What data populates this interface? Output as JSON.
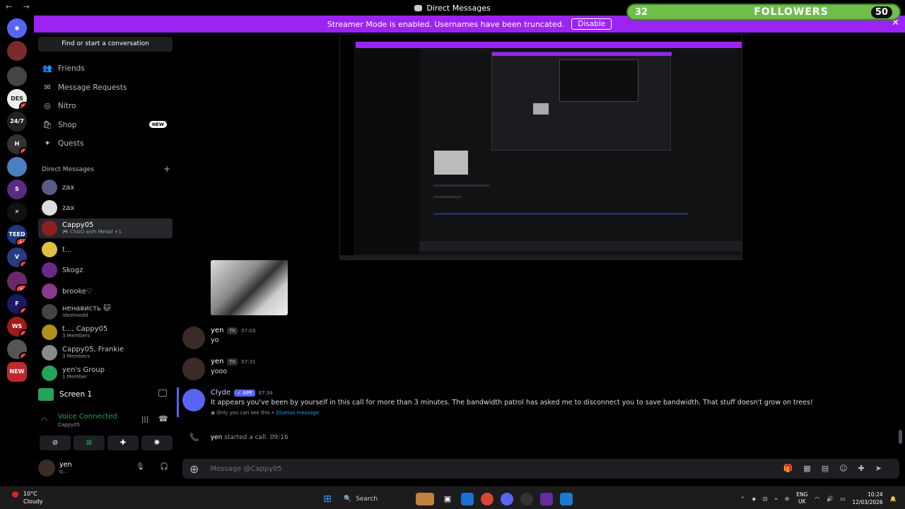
{
  "window": {
    "title": "Direct Messages",
    "nav_arrows": "← →",
    "controls": "— ▢ ✕"
  },
  "banner": {
    "text": "Streamer Mode is enabled. Usernames have been truncated.",
    "button": "Disable",
    "close": "✕"
  },
  "followers": {
    "current": "32",
    "label": "FOLLOWERS",
    "goal": "50"
  },
  "rail": {
    "servers": [
      {
        "icon": "discord-home-icon",
        "glyph": "◉",
        "color": "#5865f2",
        "badge": ""
      },
      {
        "glyph": "",
        "color": "#7a2a2a",
        "badge": ""
      },
      {
        "glyph": "",
        "color": "#444444",
        "badge": ""
      },
      {
        "glyph": "DES",
        "color": "#eeeeee",
        "badge": "1"
      },
      {
        "glyph": "24/7",
        "color": "#222222",
        "badge": ""
      },
      {
        "glyph": "H",
        "color": "#333333",
        "badge": "1"
      },
      {
        "glyph": "",
        "color": "#4a80c0",
        "badge": ""
      },
      {
        "glyph": "S",
        "color": "#5a2a80",
        "badge": ""
      },
      {
        "glyph": "✕",
        "color": "#111111",
        "badge": ""
      },
      {
        "glyph": "TEED",
        "color": "#1a3a80",
        "badge": "12"
      },
      {
        "glyph": "V",
        "color": "#2a3a80",
        "badge": "4"
      },
      {
        "glyph": "",
        "color": "#6a2a6a",
        "badge": "23"
      },
      {
        "glyph": "F",
        "color": "#1a1a60",
        "badge": "1"
      },
      {
        "glyph": "WS",
        "color": "#a01a1a",
        "badge": "1"
      },
      {
        "glyph": "",
        "color": "#555555",
        "badge": "4"
      },
      {
        "glyph": "NEW",
        "color": "#c0282d",
        "badge": ""
      }
    ]
  },
  "sidebar": {
    "find_placeholder": "Find or start a conversation",
    "nav": [
      {
        "label": "Friends",
        "icon": "👥"
      },
      {
        "label": "Message Requests",
        "icon": "✉"
      },
      {
        "label": "Nitro",
        "icon": "◎"
      },
      {
        "label": "Shop",
        "icon": "🛍",
        "tag": "NEW"
      },
      {
        "label": "Quests",
        "icon": "✦"
      }
    ],
    "dm_header": "Direct Messages",
    "dm_add": "+",
    "dms": [
      {
        "name": "zax",
        "sub": "",
        "color": "#5b5b8a"
      },
      {
        "name": "zax",
        "sub": "",
        "color": "#dddddd"
      },
      {
        "name": "Cappy05",
        "sub": "🎮 CSGO with Medal +1",
        "color": "#8a2020",
        "active": true
      },
      {
        "name": "t...",
        "sub": "",
        "color": "#e0c040"
      },
      {
        "name": "Skogz",
        "sub": "",
        "color": "#6a2a8a"
      },
      {
        "name": "brooke♡",
        "sub": "",
        "color": "#8a3a8a"
      },
      {
        "name": "ненависть 🐱",
        "sub": "/deshoodd",
        "color": "#444444"
      },
      {
        "name": "t..., Cappy05",
        "sub": "3 Members",
        "color": "#b09020"
      },
      {
        "name": "Cappy05, Frankie",
        "sub": "3 Members",
        "color": "#8a8a8a"
      },
      {
        "name": "yen's Group",
        "sub": "1 Member",
        "color": "#23a55a"
      }
    ],
    "screen_label": "Screen 1",
    "voice_title": "Voice Connected",
    "voice_sub": "Cappy05",
    "user_name": "yen",
    "user_status": "q..."
  },
  "chat": {
    "messages": [
      {
        "author": "yen",
        "tag": "TK",
        "time": "07:03",
        "text": "yo"
      },
      {
        "author": "yen",
        "tag": "TK",
        "time": "07:31",
        "text": "yooo"
      }
    ],
    "clyde": {
      "author": "Clyde",
      "badge": "✓ APP",
      "time": "07:34",
      "text": "It appears you've been by yourself in this call for more than 3 minutes. The bandwidth patrol has asked me to disconnect you to save bandwidth. That stuff doesn't grow on trees!",
      "ephemeral": "Only you can see this •",
      "dismiss": "Dismiss message"
    },
    "call": {
      "author": "yen",
      "text": "started a call.",
      "time": "09:16"
    },
    "composer_placeholder": "Message @Cappy05"
  },
  "taskbar": {
    "temp": "10°C",
    "cond": "Cloudy",
    "search": "Search",
    "lang1": "ENG",
    "lang2": "UK",
    "time": "10:24",
    "date": "12/03/2026"
  }
}
